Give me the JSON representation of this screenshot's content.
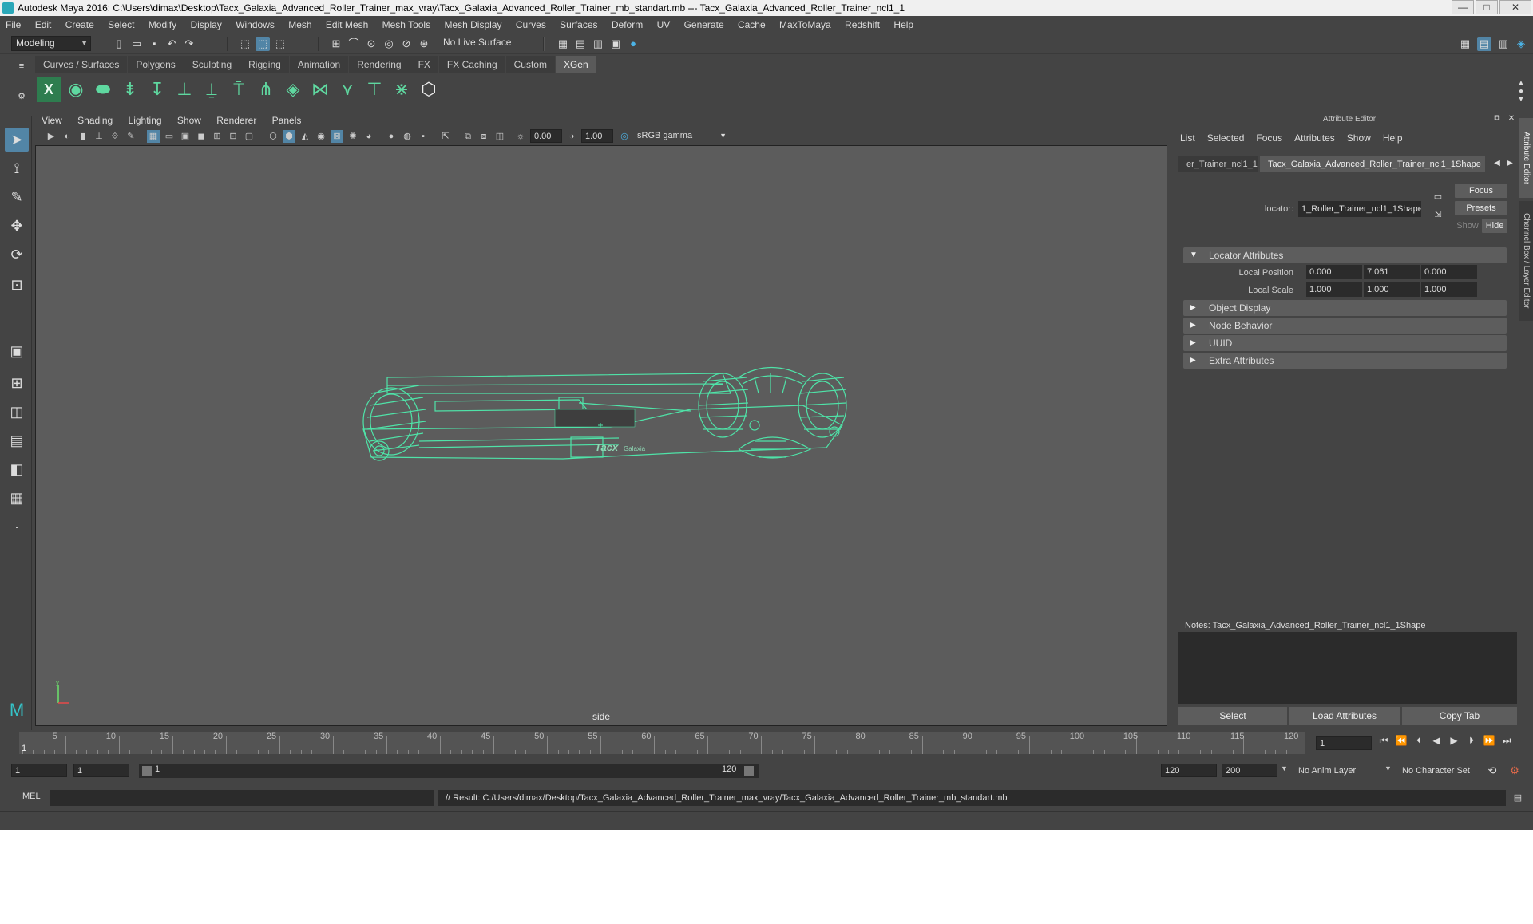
{
  "titlebar": {
    "text": "Autodesk Maya 2016: C:\\Users\\dimax\\Desktop\\Tacx_Galaxia_Advanced_Roller_Trainer_max_vray\\Tacx_Galaxia_Advanced_Roller_Trainer_mb_standart.mb   ---   Tacx_Galaxia_Advanced_Roller_Trainer_ncl1_1",
    "minimize": "—",
    "maximize": "□",
    "close": "✕"
  },
  "menubar": [
    "File",
    "Edit",
    "Create",
    "Select",
    "Modify",
    "Display",
    "Windows",
    "Mesh",
    "Edit Mesh",
    "Mesh Tools",
    "Mesh Display",
    "Curves",
    "Surfaces",
    "Deform",
    "UV",
    "Generate",
    "Cache",
    "MaxToMaya",
    "Redshift",
    "Help"
  ],
  "statusline": {
    "mode": "Modeling",
    "live_surface": "No Live Surface"
  },
  "shelf_tabs": [
    {
      "label": "Curves / Surfaces",
      "active": false
    },
    {
      "label": "Polygons",
      "active": false
    },
    {
      "label": "Sculpting",
      "active": false
    },
    {
      "label": "Rigging",
      "active": false
    },
    {
      "label": "Animation",
      "active": false
    },
    {
      "label": "Rendering",
      "active": false
    },
    {
      "label": "FX",
      "active": false
    },
    {
      "label": "FX Caching",
      "active": false
    },
    {
      "label": "Custom",
      "active": false
    },
    {
      "label": "XGen",
      "active": true
    }
  ],
  "viewport": {
    "menus": [
      "View",
      "Shading",
      "Lighting",
      "Show",
      "Renderer",
      "Panels"
    ],
    "exposure": "0.00",
    "gamma": "1.00",
    "color_space": "sRGB gamma",
    "camera_label": "side",
    "model_logo": "Tacx",
    "model_logo_sub": "Galaxia",
    "wire_color": "#4fe3a8"
  },
  "attribute_editor": {
    "title": "Attribute Editor",
    "menus": [
      "List",
      "Selected",
      "Focus",
      "Attributes",
      "Show",
      "Help"
    ],
    "tabs": [
      {
        "label": "er_Trainer_ncl1_1",
        "active": false
      },
      {
        "label": "Tacx_Galaxia_Advanced_Roller_Trainer_ncl1_1Shape",
        "active": true
      }
    ],
    "locator_label": "locator:",
    "locator_value": "1_Roller_Trainer_ncl1_1Shape",
    "focus_btn": "Focus",
    "presets_btn": "Presets",
    "show_btn": "Show",
    "hide_btn": "Hide",
    "sections": [
      {
        "label": "Locator Attributes",
        "expanded": true
      },
      {
        "label": "Object Display",
        "expanded": false
      },
      {
        "label": "Node Behavior",
        "expanded": false
      },
      {
        "label": "UUID",
        "expanded": false
      },
      {
        "label": "Extra Attributes",
        "expanded": false
      }
    ],
    "local_position": {
      "label": "Local Position",
      "x": "0.000",
      "y": "7.061",
      "z": "0.000"
    },
    "local_scale": {
      "label": "Local Scale",
      "x": "1.000",
      "y": "1.000",
      "z": "1.000"
    },
    "notes_label": "Notes:  Tacx_Galaxia_Advanced_Roller_Trainer_ncl1_1Shape",
    "buttons": {
      "select": "Select",
      "load": "Load Attributes",
      "copy": "Copy Tab"
    },
    "side_tabs": [
      "Attribute Editor",
      "Channel Box / Layer Editor"
    ]
  },
  "timeline": {
    "ticks": [
      "5",
      "10",
      "15",
      "20",
      "25",
      "30",
      "35",
      "40",
      "45",
      "50",
      "55",
      "60",
      "65",
      "70",
      "75",
      "80",
      "85",
      "90",
      "95",
      "100",
      "105",
      "110",
      "115",
      "120"
    ],
    "current_marker": "1",
    "current_frame": "1"
  },
  "range": {
    "start": "1",
    "playback_start": "1",
    "slider_start": "1",
    "slider_end": "120",
    "playback_end": "120",
    "end": "200",
    "anim_layer": "No Anim Layer",
    "character_set": "No Character Set"
  },
  "command": {
    "type": "MEL",
    "result": "// Result: C:/Users/dimax/Desktop/Tacx_Galaxia_Advanced_Roller_Trainer_max_vray/Tacx_Galaxia_Advanced_Roller_Trainer_mb_standart.mb"
  }
}
